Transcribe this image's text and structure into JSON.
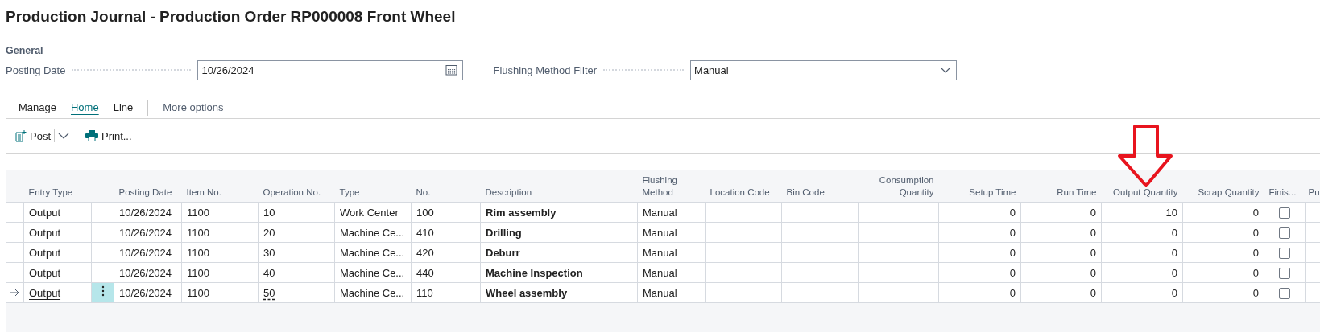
{
  "window": {
    "title": "Production Journal - Production Order RP000008 Front Wheel"
  },
  "general": {
    "heading": "General",
    "posting_date": {
      "label": "Posting Date",
      "value": "10/26/2024"
    },
    "flushing_filter": {
      "label": "Flushing Method Filter",
      "value": "Manual"
    }
  },
  "tabs": [
    {
      "label": "Manage",
      "selected": false
    },
    {
      "label": "Home",
      "selected": true
    },
    {
      "label": "Line",
      "selected": false
    },
    {
      "label": "More options",
      "selected": false,
      "kind": "more"
    }
  ],
  "actions": [
    {
      "label": "Post",
      "kind": "post"
    },
    {
      "label": "Print...",
      "kind": "print"
    }
  ],
  "table": {
    "columns": [
      {
        "kind": "indicator"
      },
      {
        "label": "Entry Type",
        "kind": "text"
      },
      {
        "kind": "menu"
      },
      {
        "label": "Posting Date",
        "kind": "text"
      },
      {
        "label": "Item No.",
        "kind": "text"
      },
      {
        "label": "Operation No.",
        "kind": "text"
      },
      {
        "label": "Type",
        "kind": "text"
      },
      {
        "label": "No.",
        "kind": "text"
      },
      {
        "label": "Description",
        "kind": "bold"
      },
      {
        "label": "Flushing Method",
        "kind": "text"
      },
      {
        "label": "Location Code",
        "kind": "text"
      },
      {
        "label": "Bin Code",
        "kind": "text"
      },
      {
        "label": "Consumption Quantity",
        "kind": "number"
      },
      {
        "label": "Setup Time",
        "kind": "number"
      },
      {
        "label": "Run Time",
        "kind": "number"
      },
      {
        "label": "Output Quantity",
        "kind": "number"
      },
      {
        "label": "Scrap Quantity",
        "kind": "number"
      },
      {
        "label": "Finis...",
        "kind": "checkbox"
      },
      {
        "label": "Pu",
        "kind": "blank"
      }
    ],
    "rows": [
      {
        "selected": false,
        "finished": false,
        "cells": [
          "",
          "Output",
          "",
          "10/26/2024",
          "1100",
          "10",
          "Work Center",
          "100",
          "Rim assembly",
          "Manual",
          "",
          "",
          "",
          "0",
          "0",
          "10",
          "0",
          "",
          ""
        ]
      },
      {
        "selected": false,
        "finished": false,
        "cells": [
          "",
          "Output",
          "",
          "10/26/2024",
          "1100",
          "20",
          "Machine Ce...",
          "410",
          "Drilling",
          "Manual",
          "",
          "",
          "",
          "0",
          "0",
          "0",
          "0",
          "",
          ""
        ]
      },
      {
        "selected": false,
        "finished": false,
        "cells": [
          "",
          "Output",
          "",
          "10/26/2024",
          "1100",
          "30",
          "Machine Ce...",
          "420",
          "Deburr",
          "Manual",
          "",
          "",
          "",
          "0",
          "0",
          "0",
          "0",
          "",
          ""
        ]
      },
      {
        "selected": false,
        "finished": false,
        "cells": [
          "",
          "Output",
          "",
          "10/26/2024",
          "1100",
          "40",
          "Machine Ce...",
          "440",
          "Machine Inspection",
          "Manual",
          "",
          "",
          "",
          "0",
          "0",
          "0",
          "0",
          "",
          ""
        ]
      },
      {
        "selected": true,
        "finished": false,
        "cells": [
          "",
          "Output",
          "",
          "10/26/2024",
          "1100",
          "50",
          "Machine Ce...",
          "110",
          "Wheel assembly",
          "Manual",
          "",
          "",
          "",
          "0",
          "0",
          "0",
          "0",
          "",
          ""
        ]
      }
    ]
  }
}
